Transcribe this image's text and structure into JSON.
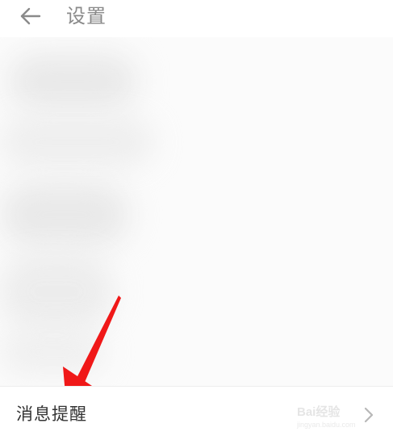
{
  "header": {
    "back_icon": "arrow-left-icon",
    "title": "设置"
  },
  "settings": {
    "items": [
      {
        "label": "消息提醒",
        "trailing_icon": "chevron-right-icon"
      }
    ]
  },
  "watermark": {
    "text": "Bai经验",
    "sub": "jingyan.baidu.com"
  },
  "annotation": {
    "color": "#f01818",
    "icon": "red-arrow-annotation"
  },
  "colors": {
    "title": "#8a8a8a",
    "text": "#333333",
    "background": "#ffffff"
  }
}
